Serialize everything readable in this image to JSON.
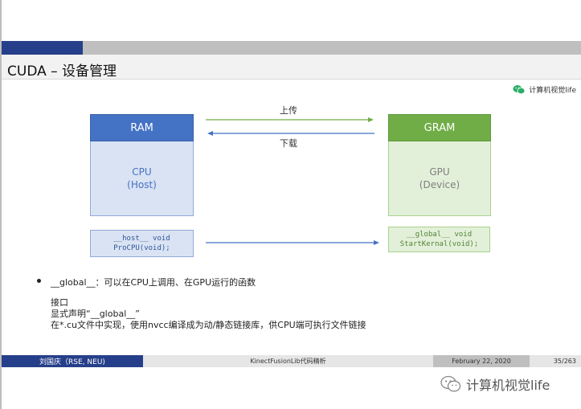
{
  "slide": {
    "title": "CUDA – 设备管理",
    "brand_small": "计算机视觉life",
    "ram": {
      "label": "RAM",
      "body_line1": "CPU",
      "body_line2": "(Host)"
    },
    "gram": {
      "label": "GRAM",
      "body_line1": "GPU",
      "body_line2": "(Device)"
    },
    "arrows": {
      "upload_label": "上传",
      "download_label": "下载"
    },
    "host_code": {
      "line1": "__host__ void",
      "line2": "ProCPU(void);"
    },
    "global_code": {
      "line1": "__global__ void",
      "line2": "StartKernal(void);"
    },
    "bullet": {
      "text": "__global__：可以在CPU上调用、在GPU运行的函数",
      "lines": [
        "接口",
        "显式声明“__global__”",
        "在*.cu文件中实现，使用nvcc编译成为动/静态链接库，供CPU端可执行文件链接"
      ]
    }
  },
  "footer": {
    "author": "刘国庆（RSE, NEU)",
    "title": "KinectFusionLib代码精析",
    "date": "February 22, 2020",
    "page": "35/263"
  },
  "watermark": {
    "text": "计算机视觉life"
  },
  "colors": {
    "accent_blue": "#4472c4",
    "accent_green": "#70ad47",
    "nav_dark": "#263f8a",
    "arrow_green": "#70ad47",
    "arrow_blue": "#4472c4"
  }
}
